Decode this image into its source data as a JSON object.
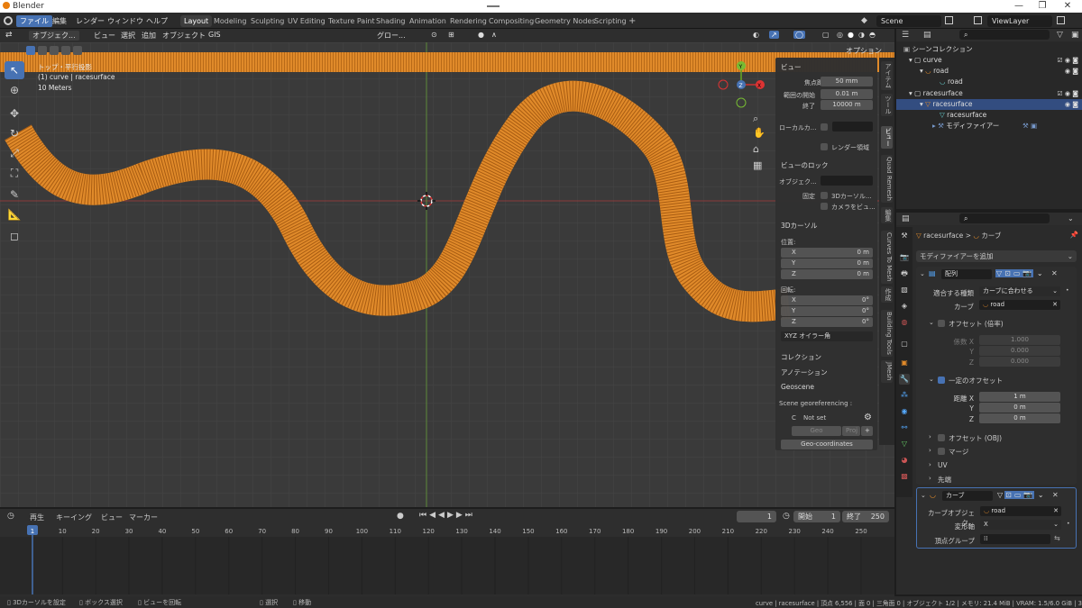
{
  "window": {
    "title": "Blender",
    "minimize": "—",
    "maximize": "❐",
    "close": "✕"
  },
  "menu": [
    "ファイル",
    "編集",
    "レンダー",
    "ウィンドウ",
    "ヘルプ"
  ],
  "workspaces": [
    "Layout",
    "Modeling",
    "Sculpting",
    "UV Editing",
    "Texture Paint",
    "Shading",
    "Animation",
    "Rendering",
    "Compositing",
    "Geometry Nodes",
    "Scripting"
  ],
  "scene": {
    "scene_name": "Scene",
    "view_layer": "ViewLayer"
  },
  "viewport_header": {
    "mode": "オブジェク...",
    "items": [
      "ビュー",
      "選択",
      "追加",
      "オブジェクト",
      "GIS"
    ],
    "transform": "グロー...",
    "options": "オプション"
  },
  "viewport_info": {
    "view": "トップ・平行投影",
    "object": "(1) curve | racesurface",
    "scale": "10 Meters"
  },
  "gizmo": {
    "x": "X",
    "y": "Y",
    "z": "Z"
  },
  "npanel": {
    "view_header": "ビュー",
    "focal_label": "焦点距離",
    "focal_value": "50 mm",
    "clip_start_label": "範囲の開始",
    "clip_start_value": "0.01 m",
    "clip_end_label": "終了",
    "clip_end_value": "10000 m",
    "local_camera_label": "ローカルカ...",
    "render_region": "レンダー領域",
    "view_lock_header": "ビューのロック",
    "lock_object_label": "オブジェク...",
    "lock_label": "固定",
    "lock_cursor": "3Dカーソル...",
    "lock_camera": "カメラをビュ...",
    "cursor_header": "3Dカーソル",
    "location_label": "位置:",
    "loc": [
      {
        "axis": "X",
        "value": "0 m"
      },
      {
        "axis": "Y",
        "value": "0 m"
      },
      {
        "axis": "Z",
        "value": "0 m"
      }
    ],
    "rotation_label": "回転:",
    "rot": [
      {
        "axis": "X",
        "value": "0°"
      },
      {
        "axis": "Y",
        "value": "0°"
      },
      {
        "axis": "Z",
        "value": "0°"
      }
    ],
    "rotation_mode": "XYZ オイラー角",
    "collection_header": "コレクション",
    "annotation_header": "アノテーション",
    "geoscene_header": "Geoscene",
    "georef_label": "Scene georeferencing :",
    "not_set": "Not set",
    "geo_btn": "Geo",
    "proj_btn": "Proj",
    "geocoords_btn": "Geo-coordinates",
    "tabs": [
      "アイテム",
      "ツール",
      "ビュー",
      "Quad Remesh",
      "編集",
      "Curves To Mesh",
      "作成",
      "Building Tools",
      "JMesh"
    ]
  },
  "timeline": {
    "menus": [
      "再生",
      "キーイング",
      "ビュー",
      "マーカー"
    ],
    "current_frame": "1",
    "start_label": "開始",
    "start_value": "1",
    "end_label": "終了",
    "end_value": "250",
    "ticks": [
      "1",
      "10",
      "20",
      "30",
      "40",
      "50",
      "60",
      "70",
      "80",
      "90",
      "100",
      "110",
      "120",
      "130",
      "140",
      "150",
      "160",
      "170",
      "180",
      "190",
      "200",
      "210",
      "220",
      "230",
      "240",
      "250"
    ]
  },
  "statusbar": {
    "hint1": "3Dカーソルを設定",
    "hint2": "ボックス選択",
    "hint3": "ビューを回転",
    "hint4": "選択",
    "hint5": "移動",
    "stats": "curve | racesurface | 頂点 6,556 | 面 0 | 三角面 0 | オブジェクト 1/2 | メモリ: 21.4 MiB | VRAM: 1.5/6.0 GiB | 3.0.0"
  },
  "outliner": {
    "rows": [
      {
        "label": "シーンコレクション",
        "indent": 0
      },
      {
        "label": "curve",
        "indent": 1
      },
      {
        "label": "road",
        "indent": 2
      },
      {
        "label": "road",
        "indent": 3
      },
      {
        "label": "racesurface",
        "indent": 1
      },
      {
        "label": "racesurface",
        "indent": 2
      },
      {
        "label": "racesurface",
        "indent": 3
      },
      {
        "label": "モディファイアー",
        "indent": 3
      }
    ]
  },
  "properties": {
    "breadcrumb_object": "racesurface",
    "breadcrumb_sep": ">",
    "breadcrumb_data": "カーブ",
    "add_modifier": "モディファイアーを追加",
    "array": {
      "name": "配列",
      "fit_type_label": "適合する種類",
      "fit_type_value": "カーブに合わせる",
      "curve_label": "カーブ",
      "curve_value": "road",
      "relative_offset": "オフセット (倍率)",
      "factor_x_label": "係数 X",
      "factor_x": "1.000",
      "factor_y_label": "Y",
      "factor_y": "0.000",
      "factor_z_label": "Z",
      "factor_z": "0.000",
      "constant_offset": "一定のオフセット",
      "dist_x_label": "距離 X",
      "dist_x": "1 m",
      "dist_y_label": "Y",
      "dist_y": "0 m",
      "dist_z_label": "Z",
      "dist_z": "0 m",
      "object_offset": "オフセット (OBJ)",
      "merge": "マージ",
      "uv": "UV",
      "caps": "先端"
    },
    "curve_mod": {
      "name": "カーブ",
      "object_label": "カーブオブジェク...",
      "object_value": "road",
      "deform_label": "変形軸",
      "deform_value": "X",
      "vgroup_label": "頂点グループ"
    }
  },
  "colors": {
    "accent": "#4772b3",
    "road": "#e08a2a",
    "grid_bg": "#3a3a3a",
    "x_axis": "#c0392b",
    "y_axis": "#6aa84f"
  }
}
